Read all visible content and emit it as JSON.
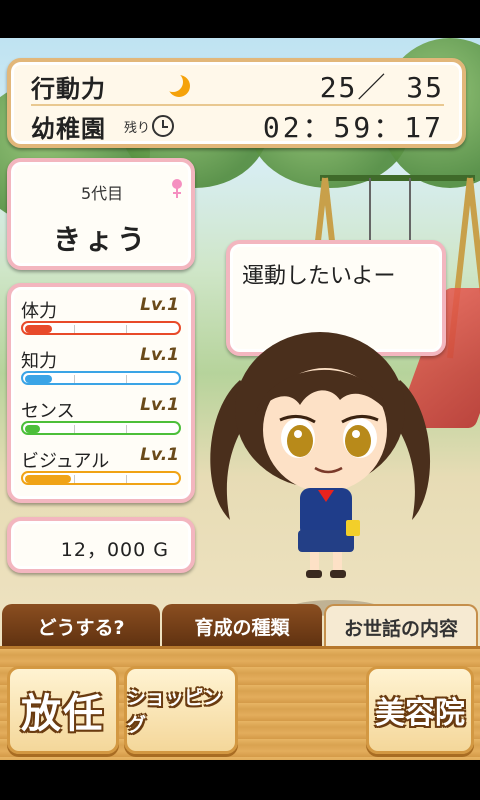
{
  "header": {
    "ap_label": "行動力",
    "ap_value": "25／ 35",
    "stage": "幼稚園",
    "remain_label": "残り",
    "timer": "02：59：17"
  },
  "character": {
    "generation": "5代目",
    "name": "きょう",
    "speech": "運動したいよー"
  },
  "stats": [
    {
      "name": "体力",
      "level": "Lv.1",
      "fill": 0.18,
      "color": "#e84a2a"
    },
    {
      "name": "知力",
      "level": "Lv.1",
      "fill": 0.18,
      "color": "#3aa4e6"
    },
    {
      "name": "センス",
      "level": "Lv.1",
      "fill": 0.1,
      "color": "#4cbf3a"
    },
    {
      "name": "ビジュアル",
      "level": "Lv.1",
      "fill": 0.3,
      "color": "#f0a316"
    }
  ],
  "money": "12，000 G",
  "tabs": [
    "どうする?",
    "育成の種類",
    "お世話の内容"
  ],
  "actions": [
    "放任",
    "ショッピング",
    "美容院"
  ],
  "icons": {
    "moon": "moon-icon",
    "clock": "clock-icon",
    "gender": "female-icon"
  }
}
